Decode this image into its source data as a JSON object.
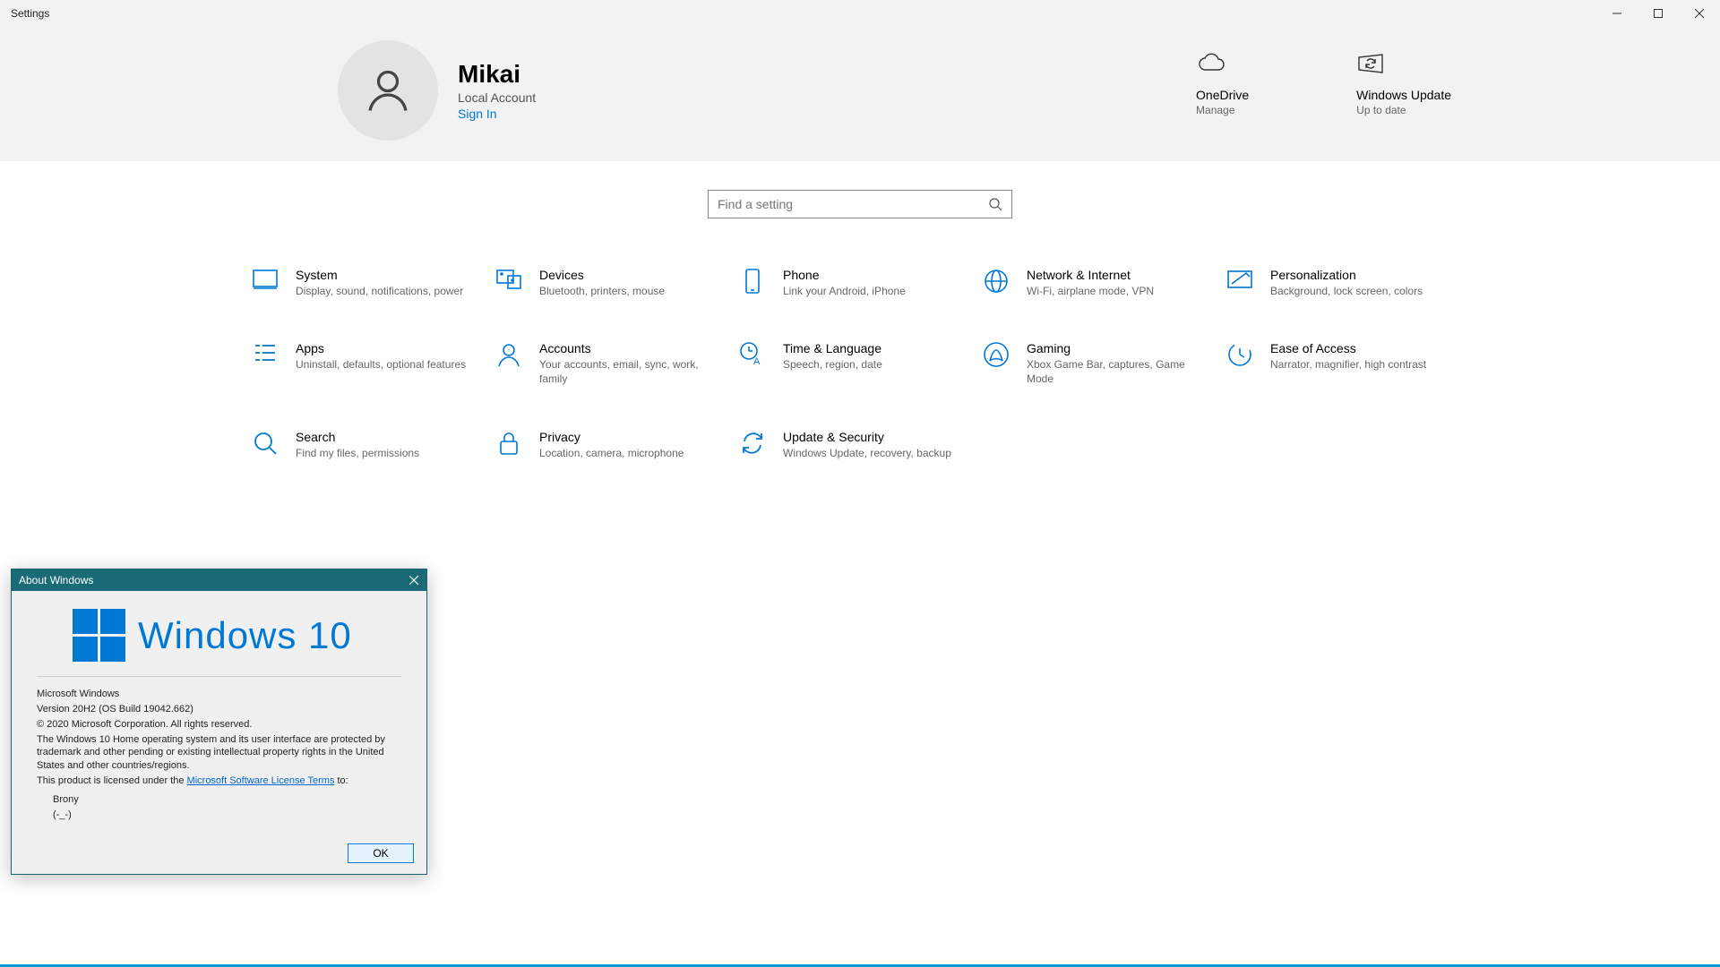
{
  "window": {
    "title": "Settings"
  },
  "account": {
    "name": "Mikai",
    "sub": "Local Account",
    "signin": "Sign In"
  },
  "header_tiles": {
    "onedrive": {
      "title": "OneDrive",
      "sub": "Manage"
    },
    "update": {
      "title": "Windows Update",
      "sub": "Up to date"
    }
  },
  "search": {
    "placeholder": "Find a setting"
  },
  "categories": [
    {
      "id": "system",
      "title": "System",
      "desc": "Display, sound, notifications, power"
    },
    {
      "id": "devices",
      "title": "Devices",
      "desc": "Bluetooth, printers, mouse"
    },
    {
      "id": "phone",
      "title": "Phone",
      "desc": "Link your Android, iPhone"
    },
    {
      "id": "network",
      "title": "Network & Internet",
      "desc": "Wi-Fi, airplane mode, VPN"
    },
    {
      "id": "personalization",
      "title": "Personalization",
      "desc": "Background, lock screen, colors"
    },
    {
      "id": "apps",
      "title": "Apps",
      "desc": "Uninstall, defaults, optional features"
    },
    {
      "id": "accounts",
      "title": "Accounts",
      "desc": "Your accounts, email, sync, work, family"
    },
    {
      "id": "time",
      "title": "Time & Language",
      "desc": "Speech, region, date"
    },
    {
      "id": "gaming",
      "title": "Gaming",
      "desc": "Xbox Game Bar, captures, Game Mode"
    },
    {
      "id": "ease",
      "title": "Ease of Access",
      "desc": "Narrator, magnifier, high contrast"
    },
    {
      "id": "search",
      "title": "Search",
      "desc": "Find my files, permissions"
    },
    {
      "id": "privacy",
      "title": "Privacy",
      "desc": "Location, camera, microphone"
    },
    {
      "id": "updatesec",
      "title": "Update & Security",
      "desc": "Windows Update, recovery, backup"
    }
  ],
  "about": {
    "title": "About Windows",
    "brand": "Windows 10",
    "l1": "Microsoft Windows",
    "l2": "Version 20H2 (OS Build 19042.662)",
    "l3": "© 2020 Microsoft Corporation. All rights reserved.",
    "para": "The Windows 10 Home operating system and its user interface are protected by trademark and other pending or existing intellectual property rights in the United States and other countries/regions.",
    "lic_pre": "This product is licensed under the ",
    "lic_link": "Microsoft Software License Terms",
    "lic_post": " to:",
    "user": "Brony",
    "face": "(-_-)",
    "ok": "OK"
  }
}
